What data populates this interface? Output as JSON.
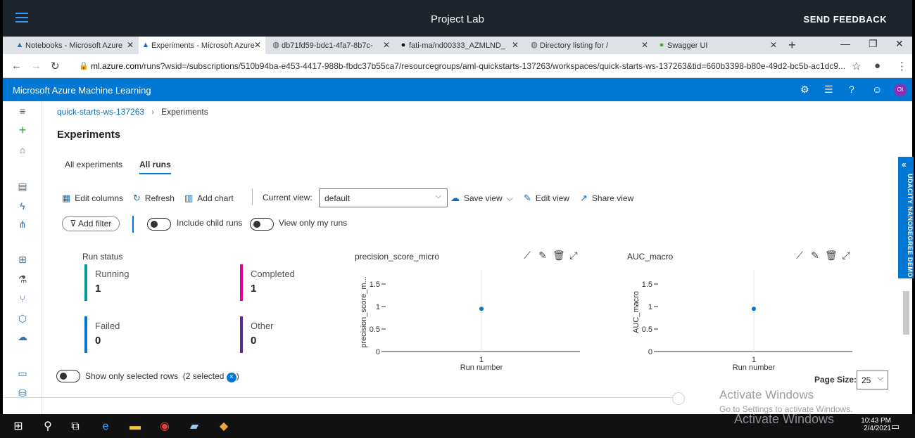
{
  "project_lab": {
    "title": "Project Lab",
    "feedback": "SEND FEEDBACK"
  },
  "browser": {
    "tabs": [
      {
        "label": "Notebooks - Microsoft Azure",
        "icon": "flask-icon",
        "active": false
      },
      {
        "label": "Experiments - Microsoft Azure",
        "icon": "flask-icon",
        "active": true
      },
      {
        "label": "db71fd59-bdc1-4fa7-8b7c-",
        "icon": "globe-icon",
        "active": false
      },
      {
        "label": "fati-ma/nd00333_AZMLND_",
        "icon": "github-icon",
        "active": false
      },
      {
        "label": "Directory listing for /",
        "icon": "globe-icon",
        "active": false
      },
      {
        "label": "Swagger UI",
        "icon": "swagger-icon",
        "active": false
      }
    ],
    "url_host": "ml.azure.com",
    "url_path": "/runs?wsid=/subscriptions/510b94ba-e453-4417-988b-fbdc37b55ca7/resourcegroups/aml-quickstarts-137263/workspaces/quick-starts-ws-137263&tid=660b3398-b80e-49d2-bc5b-ac1dc9..."
  },
  "azure": {
    "brand": "Microsoft Azure Machine Learning",
    "avatar": "OI"
  },
  "breadcrumb": {
    "workspace": "quick-starts-ws-137263",
    "current": "Experiments"
  },
  "page": {
    "title": "Experiments"
  },
  "pivots": {
    "all_experiments": "All experiments",
    "all_runs": "All runs"
  },
  "toolbar": {
    "edit_columns": "Edit columns",
    "refresh": "Refresh",
    "add_chart": "Add chart",
    "current_view_label": "Current view:",
    "current_view_value": "default",
    "save_view": "Save view",
    "edit_view": "Edit view",
    "share_view": "Share view"
  },
  "filters": {
    "add_filter": "Add filter",
    "include_child_runs": "Include child runs",
    "view_only_my_runs": "View only my runs"
  },
  "run_status": {
    "title": "Run status",
    "items": [
      {
        "label": "Running",
        "value": "1",
        "color": "#009a9a"
      },
      {
        "label": "Completed",
        "value": "1",
        "color": "#e3008c"
      },
      {
        "label": "Failed",
        "value": "0",
        "color": "#0078d4"
      },
      {
        "label": "Other",
        "value": "0",
        "color": "#5c2d91"
      }
    ]
  },
  "chart_data": [
    {
      "type": "scatter",
      "title": "precision_score_micro",
      "xlabel": "Run number",
      "ylabel": "precision_score_m...",
      "x": [
        1
      ],
      "y": [
        0.95
      ],
      "ylim": [
        0,
        1.5
      ],
      "yticks": [
        "0",
        "0.5",
        "1",
        "1.5"
      ],
      "xticks": [
        "1"
      ],
      "grid": false,
      "color": "#0078d4"
    },
    {
      "type": "scatter",
      "title": "AUC_macro",
      "xlabel": "Run number",
      "ylabel": "AUC_macro",
      "x": [
        1
      ],
      "y": [
        0.95
      ],
      "ylim": [
        0,
        1.5
      ],
      "yticks": [
        "0",
        "0.5",
        "1",
        "1.5"
      ],
      "xticks": [
        "1"
      ],
      "grid": false,
      "color": "#0078d4"
    }
  ],
  "bottom": {
    "show_selected": "Show only selected rows",
    "selected_count": "(2 selected",
    "selected_close": "×",
    "selected_suffix": ")",
    "page_size_label": "Page Size:",
    "page_size_value": "25"
  },
  "overlay": {
    "activate_title": "Activate Windows",
    "activate_sub": "Go to Settings to activate Windows.",
    "udacity": "UDACITY NANODEGREE DEMO"
  },
  "taskbar": {
    "time": "10:43 PM",
    "date": "2/4/2021"
  }
}
